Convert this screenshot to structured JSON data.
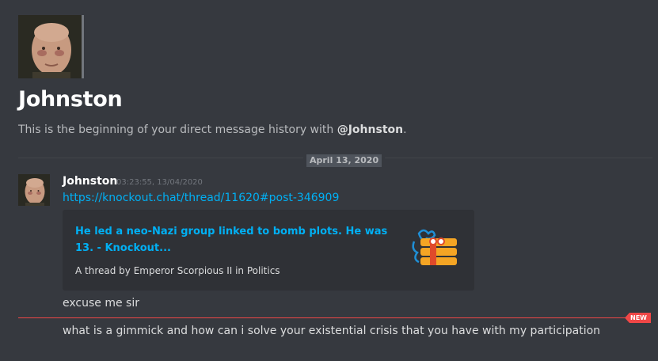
{
  "user": {
    "name": "Johnston",
    "mention": "@Johnston"
  },
  "intro": {
    "prefix": "This is the beginning of your direct message history with ",
    "suffix": "."
  },
  "date_divider": "April 13, 2020",
  "message": {
    "author": "Johnston",
    "timestamp": "03:23:55, 13/04/2020",
    "link": "https://knockout.chat/thread/11620#post-346909",
    "embed": {
      "title": "He led a neo-Nazi group linked to bomb plots. He was 13. - Knockout...",
      "description": "A thread by Emperor Scorpious II in Politics",
      "thumbnail_icon": "dynamite-icon"
    },
    "lines": [
      "excuse me sir",
      "what is a gimmick and how can i solve your existential crisis that you have with my participation"
    ]
  },
  "new_badge": "NEW",
  "colors": {
    "background": "#36393f",
    "link": "#00b0f4",
    "new_divider": "#f04747"
  }
}
